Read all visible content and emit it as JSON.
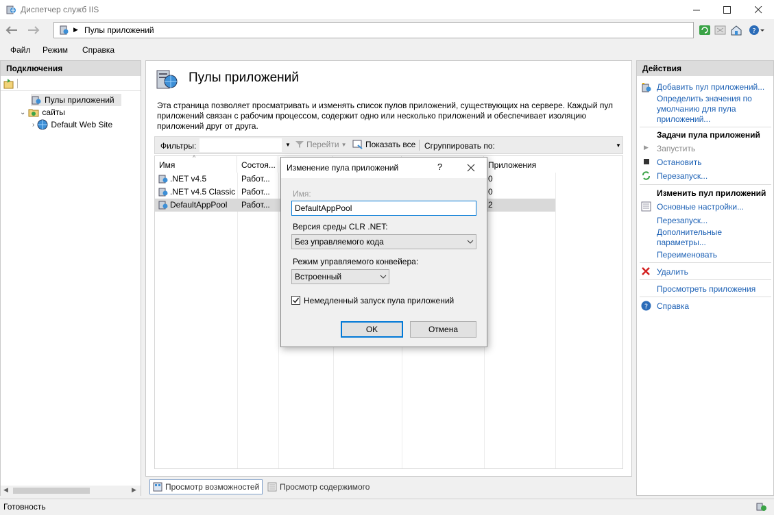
{
  "window": {
    "title": "Диспетчер служб IIS"
  },
  "address": {
    "path": "Пулы приложений"
  },
  "menu": [
    "Файл",
    "Режим",
    "Справка"
  ],
  "connections": {
    "header": "Подключения",
    "tree": [
      {
        "label": "Пулы приложений",
        "selected": true
      },
      {
        "label": "сайты"
      },
      {
        "label": "Default Web Site"
      }
    ]
  },
  "main": {
    "title": "Пулы приложений",
    "description": "Эта страница позволяет просматривать и изменять список пулов приложений, существующих на сервере. Каждый пул приложений связан с рабочим процессом, содержит одно или несколько приложений и обеспечивает изоляцию приложений друг от друга.",
    "filter_label": "Фильтры:",
    "go_label": "Перейти",
    "show_all_label": "Показать все",
    "group_label": "Сгруппировать по:",
    "columns": [
      "Имя",
      "Состоя...",
      "Приложения"
    ],
    "rows": [
      {
        "name": ".NET v4.5",
        "state": "Работ...",
        "apps": "0"
      },
      {
        "name": ".NET v4.5 Classic",
        "state": "Работ...",
        "apps": "0"
      },
      {
        "name": "DefaultAppPool",
        "state": "Работ...",
        "apps": "2"
      }
    ]
  },
  "view_tabs": [
    "Просмотр возможностей",
    "Просмотр содержимого"
  ],
  "actions": {
    "header": "Действия",
    "add_pool": "Добавить пул приложений...",
    "set_defaults": "Определить значения по умолчанию для пула приложений...",
    "tasks_header": "Задачи пула приложений",
    "start": "Запустить",
    "stop": "Остановить",
    "recycle": "Перезапуск...",
    "edit_header": "Изменить пул приложений",
    "basic_settings": "Основные настройки...",
    "recycling": "Перезапуск...",
    "advanced": "Дополнительные параметры...",
    "rename": "Переименовать",
    "delete": "Удалить",
    "view_apps": "Просмотреть приложения",
    "help": "Справка"
  },
  "status": {
    "text": "Готовность"
  },
  "dialog": {
    "title": "Изменение пула приложений",
    "help_glyph": "?",
    "name_label": "Имя:",
    "name_value": "DefaultAppPool",
    "clr_label": "Версия среды CLR .NET:",
    "clr_value": "Без управляемого кода",
    "pipeline_label": "Режим управляемого конвейера:",
    "pipeline_value": "Встроенный",
    "autostart_label": "Немедленный запуск пула приложений",
    "autostart_checked": true,
    "ok": "OK",
    "cancel": "Отмена"
  }
}
